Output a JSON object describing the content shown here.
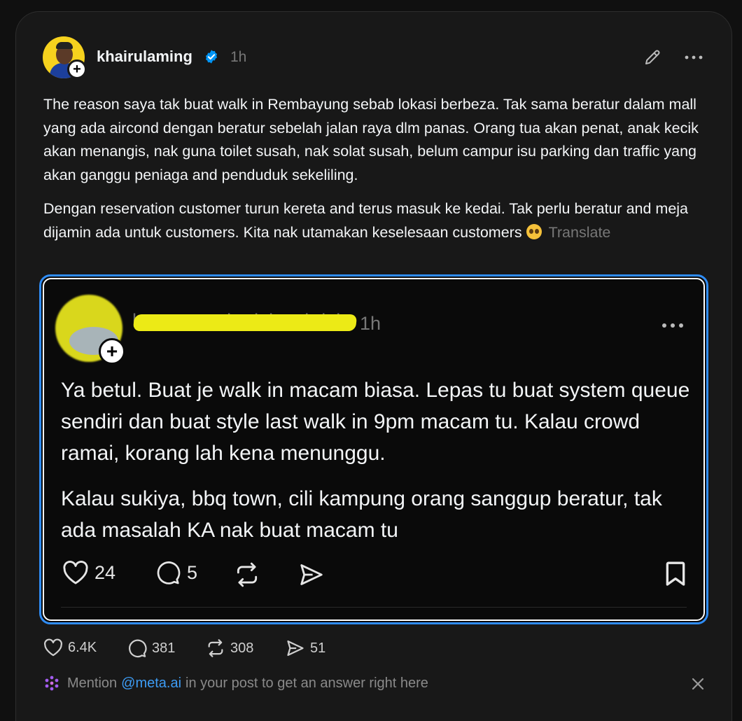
{
  "post": {
    "username": "khairulaming",
    "time": "1h",
    "paragraph1": "The reason saya tak buat walk in Rembayung sebab lokasi berbeza. Tak sama beratur dalam mall yang ada aircond dengan beratur sebelah jalan raya dlm panas. Orang tua akan penat, anak kecik akan menangis, nak guna toilet susah, nak solat susah, belum campur isu parking dan traffic yang akan ganggu peniaga and penduduk sekeliling.",
    "paragraph2": "Dengan reservation customer turun kereta and terus masuk ke kedai. Tak perlu beratur and meja dijamin ada untuk customers. Kita nak utamakan keselesaan customers",
    "translate_label": "Translate",
    "likes": "6.4K",
    "replies": "381",
    "reposts": "308",
    "shares": "51"
  },
  "quoted": {
    "username_redacted": "h________lordalogabriel",
    "time": "1h",
    "paragraph1": "Ya betul. Buat je walk in macam biasa. Lepas tu buat system queue sendiri dan buat style last walk in 9pm macam tu. Kalau crowd ramai, korang lah kena menunggu.",
    "paragraph2": "Kalau sukiya, bbq town, cili kampung orang sanggup beratur, tak ada masalah KA nak buat macam tu",
    "likes": "24",
    "replies": "5"
  },
  "meta_prompt": {
    "prefix": "Mention",
    "handle": "@meta.ai",
    "suffix": "in your post to get an answer right here"
  },
  "colors": {
    "background": "#101010",
    "card": "#181818",
    "accent_blue": "#2f8cf5",
    "verified_blue": "#0095f6",
    "redaction_yellow": "#ecea16"
  },
  "icons": [
    "plus-icon",
    "verified-badge-icon",
    "edit-icon",
    "more-icon",
    "heart-icon",
    "comment-icon",
    "repost-icon",
    "share-icon",
    "bookmark-icon",
    "meta-ai-icon",
    "close-icon"
  ]
}
